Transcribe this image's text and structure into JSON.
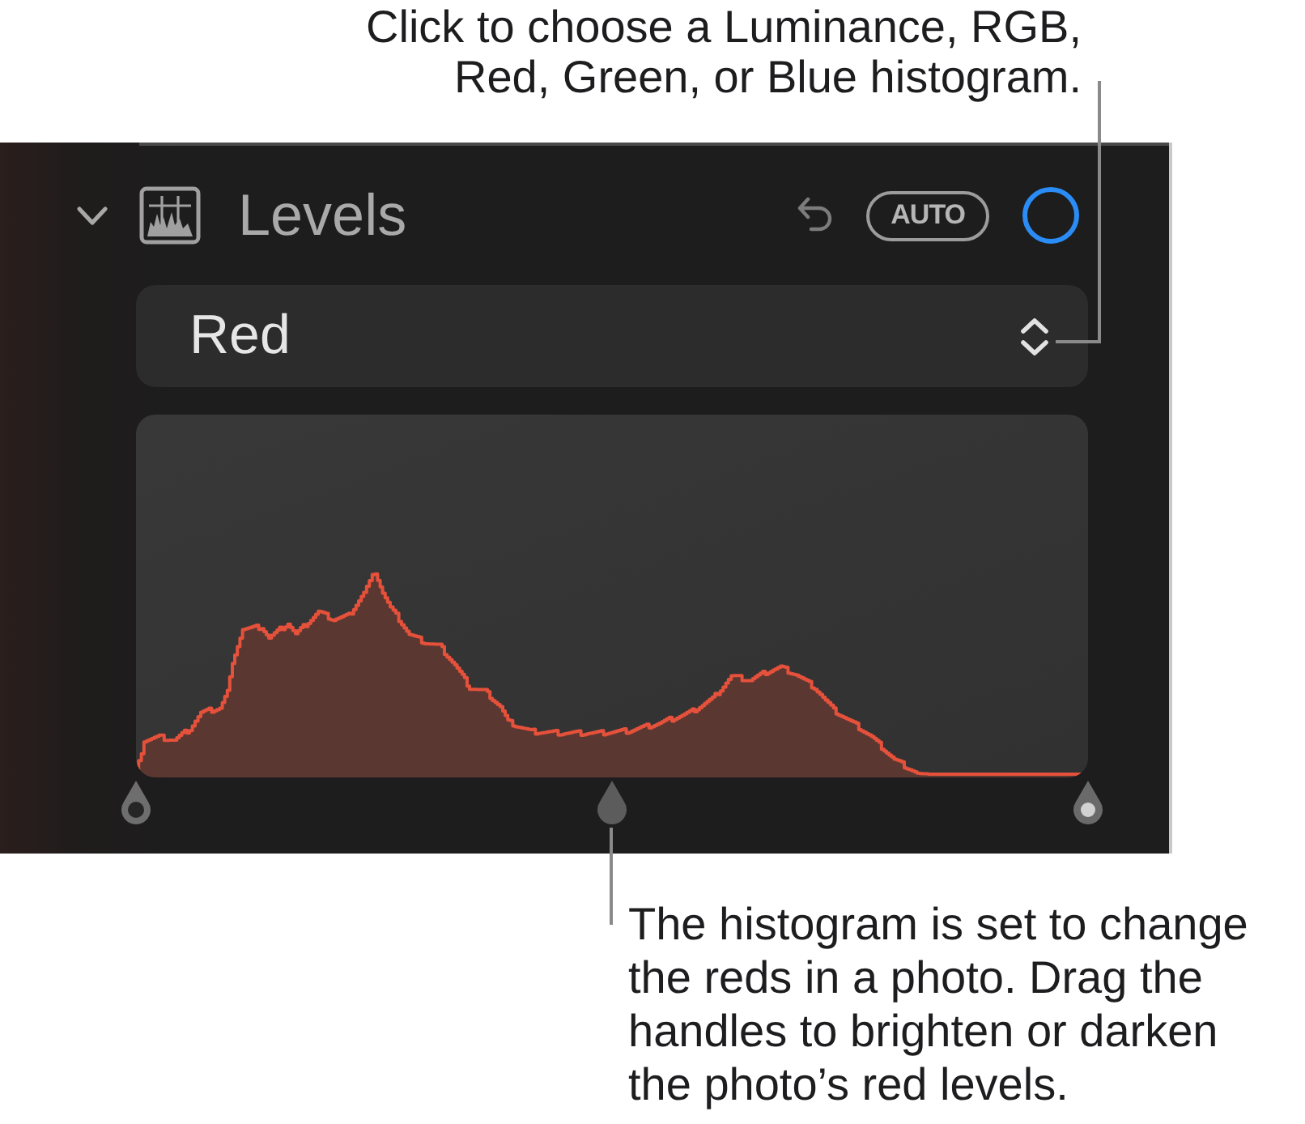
{
  "callout_top": {
    "text": "Click to choose a Luminance, RGB, Red, Green, or Blue histogram."
  },
  "section": {
    "title": "Levels",
    "expanded": true,
    "auto_button": "AUTO"
  },
  "channel_select": {
    "value": "Red"
  },
  "histogram": {
    "handles": [
      {
        "kind": "shadows",
        "level": 0
      },
      {
        "kind": "midtones",
        "level": 0.5
      },
      {
        "kind": "highlights",
        "level": 1
      }
    ]
  },
  "callout_bottom": {
    "text": "The histogram is set to change the reds in a photo. Drag the handles to brighten or darken the photo’s red levels."
  }
}
